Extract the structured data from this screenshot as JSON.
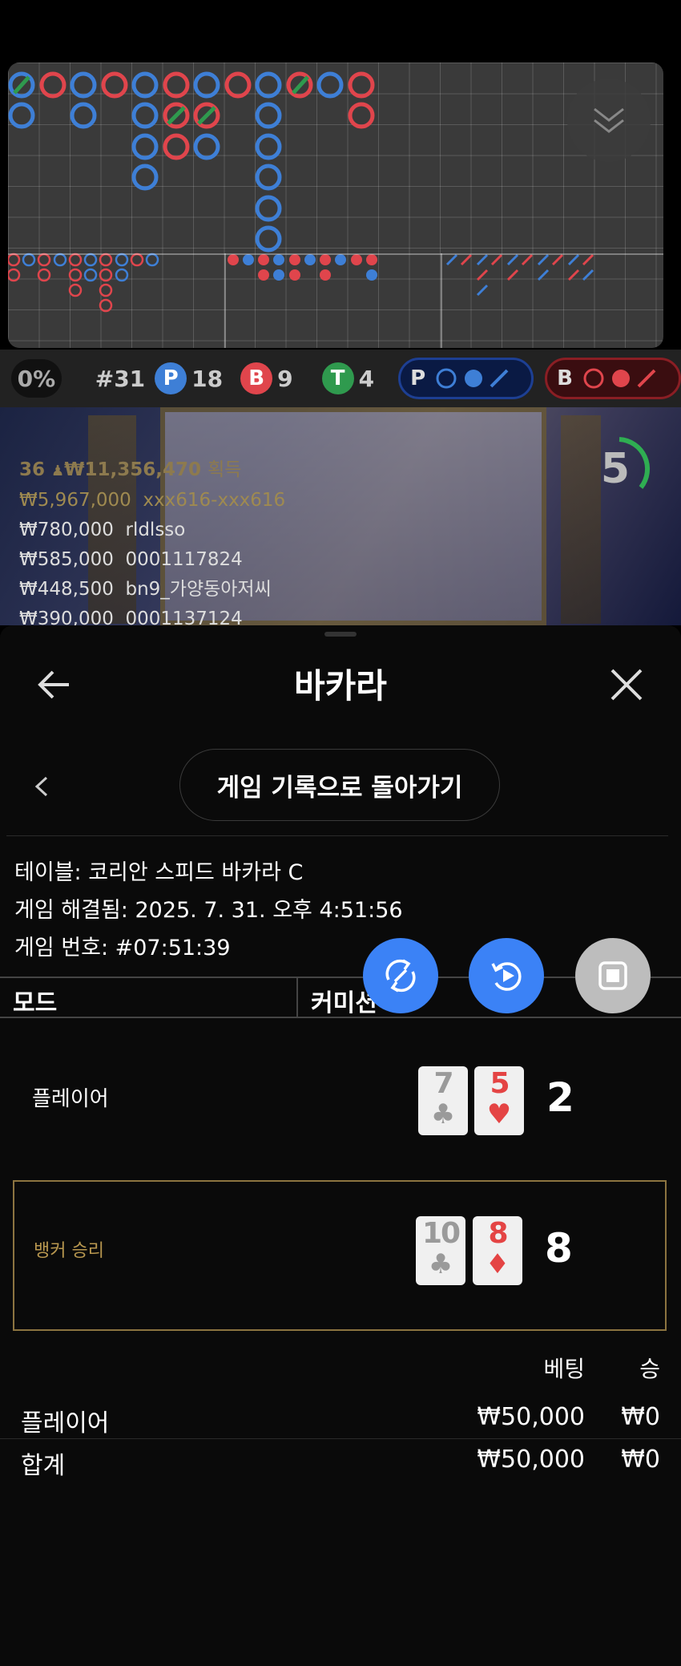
{
  "stats": {
    "win_pct": "0%",
    "round": "#31",
    "player_letter": "P",
    "player_count": "18",
    "banker_letter": "B",
    "banker_count": "9",
    "tie_letter": "T",
    "tie_count": "4",
    "player_predict": "P",
    "banker_predict": "B"
  },
  "colors": {
    "player": "#3e7fd6",
    "banker": "#e0454c",
    "tie": "#2f9a4e",
    "gold": "#b8974f",
    "fab_blue": "#3b82f6",
    "fab_grey": "#bdbdbd"
  },
  "winners": {
    "summary": {
      "count": "36",
      "amount": "₩11,356,470",
      "suffix": "획득"
    },
    "rows": [
      {
        "amount": "₩5,967,000",
        "name": "xxx616-xxx616"
      },
      {
        "amount": "₩780,000",
        "name": "rldlsso"
      },
      {
        "amount": "₩585,000",
        "name": "0001117824"
      },
      {
        "amount": "₩448,500",
        "name": "bn9_가양동아저씨"
      },
      {
        "amount": "₩390,000",
        "name": "0001137124"
      }
    ]
  },
  "timer": {
    "value": "5"
  },
  "header": {
    "title": "바카라"
  },
  "back_button": "게임 기록으로 돌아가기",
  "info": {
    "table": "테이블: 코리안 스피드 바카라 C",
    "resolved": "게임 해결됨: 2025. 7. 31. 오후 4:51:56",
    "game_no": "게임 번호: #07:51:39"
  },
  "mode_header": {
    "mode": "모드",
    "commission": "커미션"
  },
  "hands": {
    "player": {
      "label": "플레이어",
      "cards": [
        {
          "rank": "7",
          "suit": "♣"
        },
        {
          "rank": "5",
          "suit": "♥"
        }
      ],
      "score": "2"
    },
    "banker": {
      "label": "뱅커 승리",
      "cards": [
        {
          "rank": "10",
          "suit": "♣"
        },
        {
          "rank": "8",
          "suit": "♦"
        }
      ],
      "score": "8"
    }
  },
  "bet_table": {
    "headers": {
      "bet": "베팅",
      "win": "승"
    },
    "rows": [
      {
        "label": "플레이어",
        "bet": "₩50,000",
        "win": "₩0"
      },
      {
        "label": "합계",
        "bet": "₩50,000",
        "win": "₩0"
      }
    ]
  }
}
